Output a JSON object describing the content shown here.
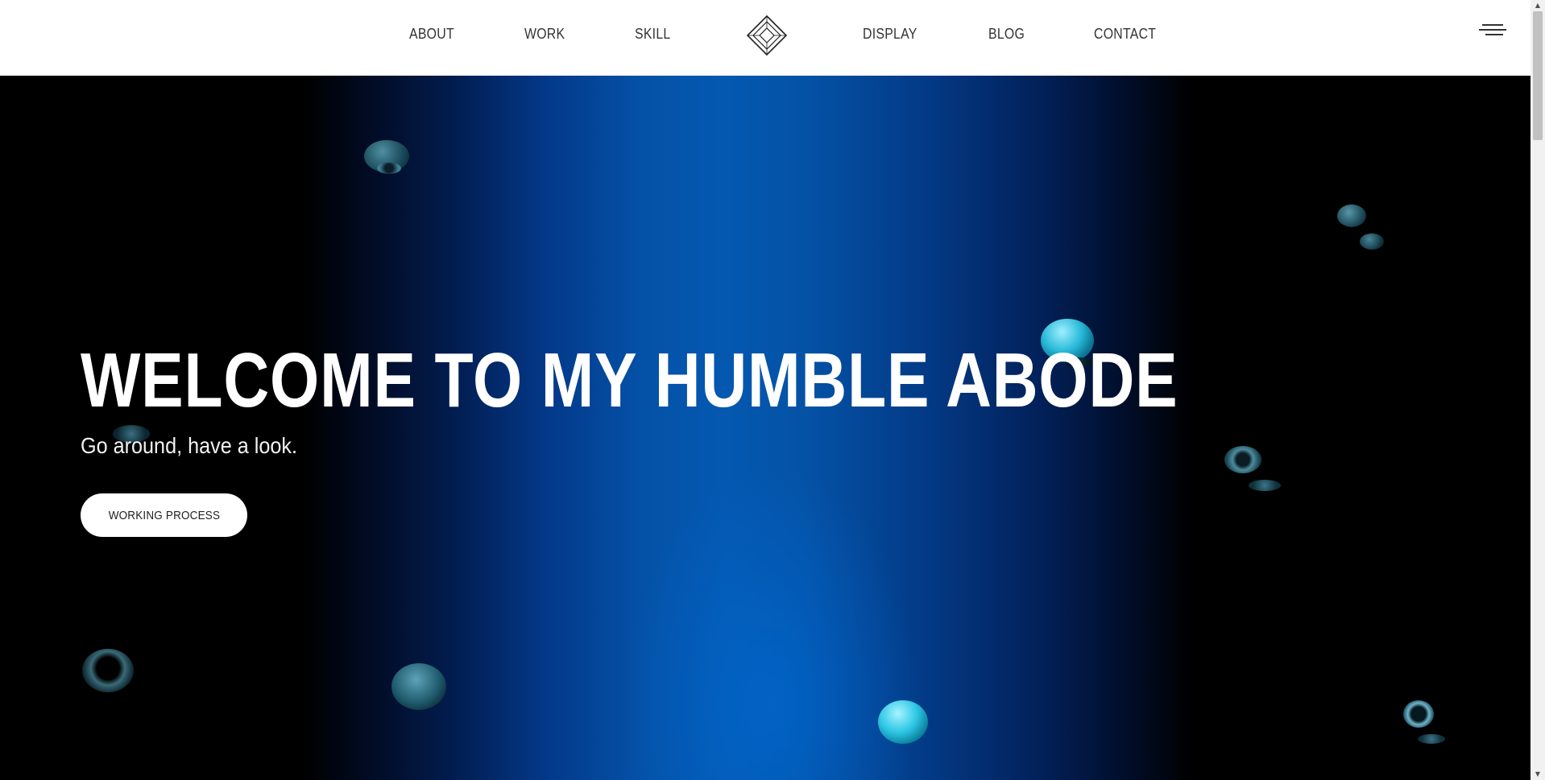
{
  "nav": {
    "left": [
      {
        "label": "ABOUT"
      },
      {
        "label": "WORK"
      },
      {
        "label": "SKILL"
      }
    ],
    "right": [
      {
        "label": "DISPLAY"
      },
      {
        "label": "BLOG"
      },
      {
        "label": "CONTACT"
      }
    ],
    "logo_icon": "diamond-logo-icon",
    "menu_icon": "hamburger-menu-icon"
  },
  "hero": {
    "title": "WELCOME TO MY HUMBLE ABODE",
    "subtitle": "Go around, have a look.",
    "cta_label": "WORKING PROCESS"
  },
  "colors": {
    "header_bg": "#ffffff",
    "nav_text": "#333333",
    "hero_bg": "#000000",
    "beam_blue": "#0458b0",
    "orb_cyan": "#1ec8e6",
    "text_white": "#ffffff"
  }
}
